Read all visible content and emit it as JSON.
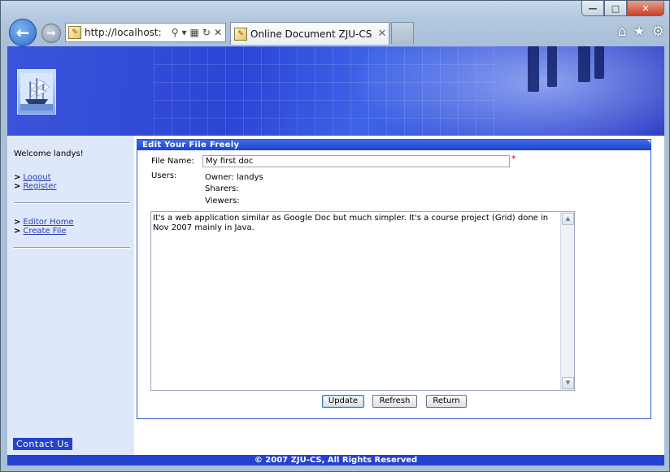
{
  "browser": {
    "address_url": "http://localhost:",
    "tab_title": "Online Document ZJU-CS",
    "favicon_icon": "page-favicon",
    "window_controls": {
      "minimize": "—",
      "maximize": "□",
      "close": "✕"
    },
    "toolbar_icons": {
      "home": "⌂",
      "favorites": "★",
      "tools": "⚙"
    }
  },
  "sidebar": {
    "welcome": "Welcome landys!",
    "group1": [
      {
        "label": "Logout"
      },
      {
        "label": "Register"
      }
    ],
    "group2": [
      {
        "label": "Editor Home"
      },
      {
        "label": "Create File"
      }
    ],
    "arrow": ">",
    "contact": "Contact Us"
  },
  "editor": {
    "heading": "Edit Your File Freely",
    "file_name_label": "File Name:",
    "file_name_value": "My first doc",
    "required_mark": "*",
    "users_label": "Users:",
    "owner": "Owner: landys",
    "sharers": "Sharers:",
    "viewers": "Viewers:",
    "content": "It's a web application similar as Google Doc but much simpler. It's a course project (Grid) done in Nov 2007 mainly in Java.",
    "buttons": {
      "update": "Update",
      "refresh": "Refresh",
      "return": "Return"
    }
  },
  "footer": {
    "copyright": "© 2007 ZJU-CS, All Rights Reserved"
  },
  "colors": {
    "accent": "#2442cf",
    "link": "#2640b3",
    "sidebar_bg": "#dfe7fb",
    "required": "#dd0000"
  }
}
